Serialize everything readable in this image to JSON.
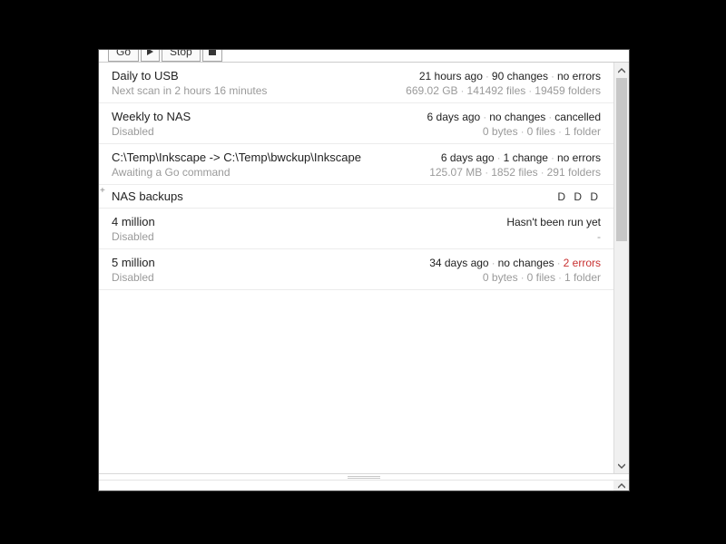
{
  "toolbar": {
    "go_label": "Go",
    "stop_label": "Stop"
  },
  "jobs": [
    {
      "name": "Daily to USB",
      "sub": "Next scan in 2 hours 16 minutes",
      "status": [
        {
          "t": "21 hours ago"
        },
        {
          "t": "90 changes"
        },
        {
          "t": "no errors"
        }
      ],
      "stats": [
        {
          "t": "669.02 GB"
        },
        {
          "t": "141492 files"
        },
        {
          "t": "19459 folders"
        }
      ]
    },
    {
      "name": "Weekly to NAS",
      "sub": "Disabled",
      "status": [
        {
          "t": "6 days ago"
        },
        {
          "t": "no changes"
        },
        {
          "t": "cancelled"
        }
      ],
      "stats": [
        {
          "t": "0 bytes"
        },
        {
          "t": "0 files"
        },
        {
          "t": "1 folder"
        }
      ]
    },
    {
      "name": "C:\\Temp\\Inkscape -> C:\\Temp\\bwckup\\Inkscape",
      "sub": "Awaiting a Go command",
      "status": [
        {
          "t": "6 days ago"
        },
        {
          "t": "1 change"
        },
        {
          "t": "no errors"
        }
      ],
      "stats": [
        {
          "t": "125.07 MB"
        },
        {
          "t": "1852 files"
        },
        {
          "t": "291 folders"
        }
      ]
    }
  ],
  "group": {
    "name": "NAS backups",
    "marker": "D D D"
  },
  "jobs2": [
    {
      "name": "4 million",
      "sub": "Disabled",
      "status_text": "Hasn't been run yet",
      "stats_text": "-"
    },
    {
      "name": "5 million",
      "sub": "Disabled",
      "status": [
        {
          "t": "34 days ago"
        },
        {
          "t": "no changes"
        },
        {
          "t": "2 errors",
          "err": true
        }
      ],
      "stats": [
        {
          "t": "0 bytes"
        },
        {
          "t": "0 files"
        },
        {
          "t": "1 folder"
        }
      ]
    }
  ],
  "sep": "·"
}
